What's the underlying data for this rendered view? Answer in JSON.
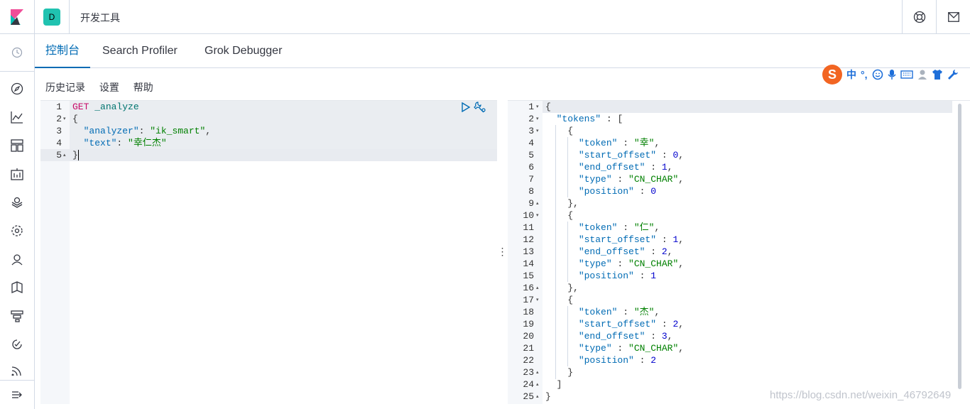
{
  "header": {
    "space_initial": "D",
    "app_title": "开发工具"
  },
  "tabs": [
    {
      "label": "控制台",
      "active": true
    },
    {
      "label": "Search Profiler",
      "active": false
    },
    {
      "label": "Grok Debugger",
      "active": false
    }
  ],
  "menu": {
    "history": "历史记录",
    "settings": "设置",
    "help": "帮助"
  },
  "ime": {
    "logo": "S",
    "lang": "中",
    "punct": "°,"
  },
  "request": {
    "lines": [
      {
        "n": "1",
        "fold": ""
      },
      {
        "n": "2",
        "fold": "▾"
      },
      {
        "n": "3",
        "fold": ""
      },
      {
        "n": "4",
        "fold": ""
      },
      {
        "n": "5",
        "fold": "▴"
      }
    ],
    "method": "GET",
    "path": "_analyze",
    "open_brace": "{",
    "analyzer_key": "\"analyzer\"",
    "analyzer_value": "\"ik_smart\"",
    "text_key": "\"text\"",
    "text_value": "\"幸仁杰\"",
    "close_brace": "}"
  },
  "response": {
    "line_numbers": [
      "1",
      "2",
      "3",
      "4",
      "5",
      "6",
      "7",
      "8",
      "9",
      "10",
      "11",
      "12",
      "13",
      "14",
      "15",
      "16",
      "17",
      "18",
      "19",
      "20",
      "21",
      "22",
      "23",
      "24",
      "25"
    ],
    "folds": [
      "▾",
      "▾",
      "▾",
      "",
      "",
      "",
      "",
      "",
      "▴",
      "▾",
      "",
      "",
      "",
      "",
      "",
      "▴",
      "▾",
      "",
      "",
      "",
      "",
      "",
      "▴",
      "▴",
      "▴"
    ],
    "lines": [
      "{",
      "  \"tokens\" : [",
      "    {",
      "      \"token\" : \"幸\",",
      "      \"start_offset\" : 0,",
      "      \"end_offset\" : 1,",
      "      \"type\" : \"CN_CHAR\",",
      "      \"position\" : 0",
      "    },",
      "    {",
      "      \"token\" : \"仁\",",
      "      \"start_offset\" : 1,",
      "      \"end_offset\" : 2,",
      "      \"type\" : \"CN_CHAR\",",
      "      \"position\" : 1",
      "    },",
      "    {",
      "      \"token\" : \"杰\",",
      "      \"start_offset\" : 2,",
      "      \"end_offset\" : 3,",
      "      \"type\" : \"CN_CHAR\",",
      "      \"position\" : 2",
      "    }",
      "  ]",
      "}"
    ]
  },
  "watermark": "https://blog.csdn.net/weixin_46792649"
}
